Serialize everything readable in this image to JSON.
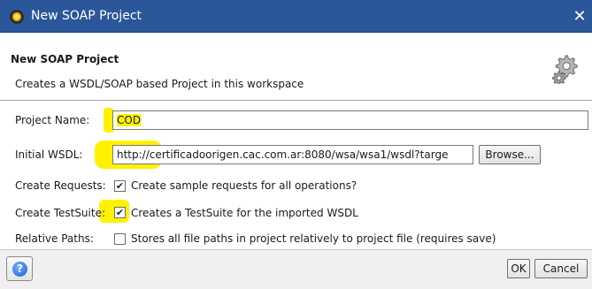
{
  "window": {
    "title": "New SOAP Project",
    "close_label": "✕"
  },
  "header": {
    "title": "New SOAP Project",
    "description": "Creates a WSDL/SOAP based Project in this workspace",
    "icon": "gears-icon"
  },
  "form": {
    "project_name": {
      "label": "Project Name:",
      "value": "COD"
    },
    "initial_wsdl": {
      "label": "Initial WSDL:",
      "value": "http://certificadoorigen.cac.com.ar:8080/wsa/wsa1/wsdl?targe",
      "browse_label": "Browse..."
    },
    "create_requests": {
      "label": "Create Requests:",
      "checked": true,
      "text": "Create sample requests for all operations?"
    },
    "create_testsuite": {
      "label": "Create TestSuite:",
      "checked": true,
      "text": "Creates a TestSuite for the imported WSDL"
    },
    "relative_paths": {
      "label": "Relative Paths:",
      "checked": false,
      "text": "Stores all file paths in project relatively to project file (requires save)"
    }
  },
  "footer": {
    "help_label": "?",
    "ok_label": "OK",
    "cancel_label": "Cancel"
  },
  "colors": {
    "titlebar": "#2b579a",
    "highlight": "#fff200"
  }
}
